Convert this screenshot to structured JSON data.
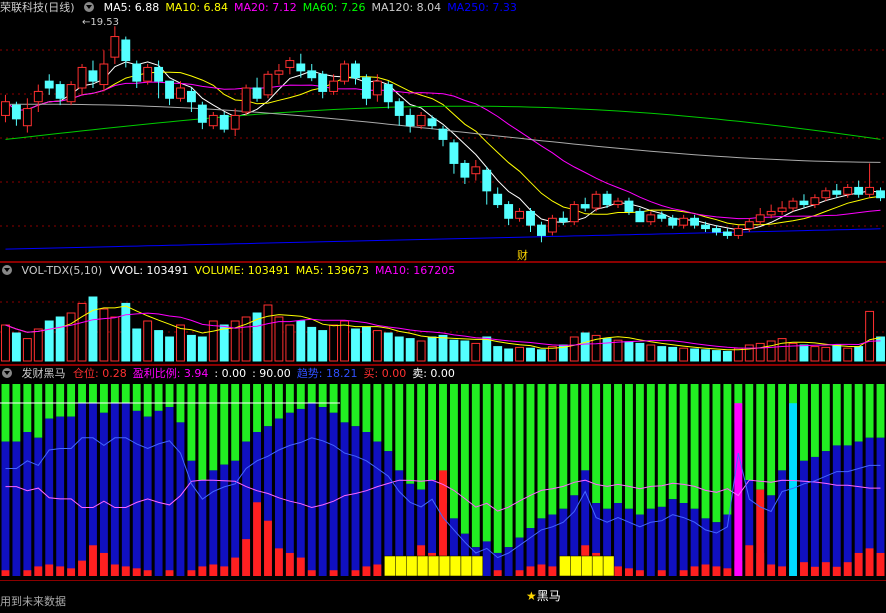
{
  "price": {
    "title": "荣联科技(日线)",
    "ma": [
      {
        "label": "MA5: 6.88",
        "color": "#ffffff"
      },
      {
        "label": "MA10: 6.84",
        "color": "#ffff00"
      },
      {
        "label": "MA20: 7.12",
        "color": "#ff00ff"
      },
      {
        "label": "MA60: 7.26",
        "color": "#00ff00"
      },
      {
        "label": "MA120: 8.04",
        "color": "#cccccc"
      },
      {
        "label": "MA250: 7.33",
        "color": "#0000ff"
      }
    ],
    "high_label": "19.53",
    "marker_cai": "财"
  },
  "volume": {
    "title": "VOL-TDX(5,10)",
    "items": [
      {
        "label": "VVOL: 103491",
        "color": "#ffffff"
      },
      {
        "label": "VOLUME: 103491",
        "color": "#ffff00"
      },
      {
        "label": "MA5: 139673",
        "color": "#ffff00"
      },
      {
        "label": "MA10: 167205",
        "color": "#ff00ff"
      }
    ]
  },
  "indicator": {
    "title": "发财黑马",
    "items": [
      {
        "label": "仓位: 0.28",
        "color": "#ff3030"
      },
      {
        "label": "盈利比例: 3.94",
        "color": "#ff00ff"
      },
      {
        "label": ": 0.00",
        "color": "#ffffff"
      },
      {
        "label": ": 90.00",
        "color": "#ffffff"
      },
      {
        "label": "趋势: 18.21",
        "color": "#3050ff"
      },
      {
        "label": "买: 0.00",
        "color": "#ff3030"
      },
      {
        "label": "卖: 0.00",
        "color": "#ffffff"
      }
    ],
    "star_label": "黑马"
  },
  "footer": {
    "note": "用到未来数据"
  },
  "colors": {
    "up": "#ff3030",
    "down": "#54ffff",
    "bg": "#000000"
  },
  "chart_data": {
    "type": "candlestick",
    "candles": [
      [
        7.9,
        8.3,
        7.7,
        8.5
      ],
      [
        8.2,
        7.8,
        7.6,
        8.3
      ],
      [
        7.6,
        8.1,
        7.4,
        8.4
      ],
      [
        8.3,
        8.6,
        8.0,
        8.8
      ],
      [
        8.9,
        8.7,
        8.5,
        9.1
      ],
      [
        8.8,
        8.4,
        8.2,
        8.9
      ],
      [
        8.3,
        8.8,
        8.2,
        8.9
      ],
      [
        8.7,
        9.3,
        8.5,
        9.4
      ],
      [
        9.2,
        8.9,
        8.7,
        9.5
      ],
      [
        8.8,
        9.4,
        8.6,
        9.8
      ],
      [
        9.6,
        10.2,
        9.4,
        10.5
      ],
      [
        10.1,
        9.5,
        9.3,
        10.2
      ],
      [
        9.4,
        8.9,
        8.7,
        9.5
      ],
      [
        8.9,
        9.3,
        8.8,
        9.4
      ],
      [
        9.3,
        8.9,
        8.4,
        9.5
      ],
      [
        8.9,
        8.4,
        8.2,
        8.9
      ],
      [
        8.4,
        8.7,
        8.3,
        8.9
      ],
      [
        8.6,
        8.3,
        8.0,
        8.7
      ],
      [
        8.2,
        7.7,
        7.5,
        8.3
      ],
      [
        7.6,
        7.9,
        7.5,
        8.0
      ],
      [
        7.9,
        7.5,
        7.4,
        8.0
      ],
      [
        7.5,
        7.9,
        7.3,
        8.1
      ],
      [
        8.0,
        8.7,
        7.9,
        8.8
      ],
      [
        8.7,
        8.4,
        8.3,
        9.0
      ],
      [
        8.5,
        9.1,
        8.4,
        9.2
      ],
      [
        9.1,
        9.2,
        8.8,
        9.4
      ],
      [
        9.3,
        9.5,
        9.1,
        9.6
      ],
      [
        9.4,
        9.2,
        9.0,
        9.7
      ],
      [
        9.2,
        9.0,
        8.9,
        9.4
      ],
      [
        9.1,
        8.6,
        8.4,
        9.2
      ],
      [
        8.6,
        8.9,
        8.5,
        9.1
      ],
      [
        8.9,
        9.4,
        8.8,
        9.5
      ],
      [
        9.4,
        9.0,
        8.8,
        9.5
      ],
      [
        9.0,
        8.4,
        8.2,
        9.1
      ],
      [
        8.5,
        8.9,
        8.3,
        9.1
      ],
      [
        8.8,
        8.3,
        8.1,
        8.9
      ],
      [
        8.3,
        7.9,
        7.6,
        8.4
      ],
      [
        7.9,
        7.6,
        7.4,
        8.1
      ],
      [
        7.6,
        7.9,
        7.5,
        8.0
      ],
      [
        7.8,
        7.6,
        7.5,
        7.9
      ],
      [
        7.5,
        7.2,
        7.0,
        7.6
      ],
      [
        7.1,
        6.5,
        6.2,
        7.2
      ],
      [
        6.5,
        6.1,
        5.9,
        6.6
      ],
      [
        6.2,
        6.4,
        6.0,
        6.6
      ],
      [
        6.3,
        5.7,
        5.3,
        6.4
      ],
      [
        5.6,
        5.3,
        5.2,
        5.8
      ],
      [
        5.3,
        4.9,
        4.7,
        5.4
      ],
      [
        4.9,
        5.1,
        4.8,
        5.2
      ],
      [
        5.1,
        4.7,
        4.5,
        5.2
      ],
      [
        4.7,
        4.4,
        4.2,
        4.8
      ],
      [
        4.5,
        4.9,
        4.4,
        5.0
      ],
      [
        4.9,
        4.8,
        4.7,
        5.1
      ],
      [
        4.8,
        5.3,
        4.7,
        5.4
      ],
      [
        5.3,
        5.2,
        5.1,
        5.5
      ],
      [
        5.2,
        5.6,
        5.1,
        5.7
      ],
      [
        5.6,
        5.3,
        5.2,
        5.7
      ],
      [
        5.3,
        5.4,
        5.2,
        5.5
      ],
      [
        5.4,
        5.1,
        5.0,
        5.5
      ],
      [
        5.1,
        4.8,
        4.8,
        5.2
      ],
      [
        4.8,
        5.0,
        4.7,
        5.1
      ],
      [
        5.0,
        4.9,
        4.8,
        5.1
      ],
      [
        4.9,
        4.7,
        4.6,
        5.0
      ],
      [
        4.7,
        4.9,
        4.6,
        5.0
      ],
      [
        4.9,
        4.7,
        4.6,
        5.0
      ],
      [
        4.7,
        4.6,
        4.5,
        4.8
      ],
      [
        4.6,
        4.5,
        4.4,
        4.7
      ],
      [
        4.5,
        4.4,
        4.3,
        4.6
      ],
      [
        4.4,
        4.6,
        4.3,
        4.7
      ],
      [
        4.6,
        4.8,
        4.5,
        4.9
      ],
      [
        4.8,
        5.0,
        4.7,
        5.2
      ],
      [
        5.0,
        5.1,
        4.9,
        5.3
      ],
      [
        5.1,
        5.2,
        5.0,
        5.4
      ],
      [
        5.2,
        5.4,
        5.1,
        5.5
      ],
      [
        5.4,
        5.3,
        5.2,
        5.6
      ],
      [
        5.3,
        5.5,
        5.2,
        5.6
      ],
      [
        5.5,
        5.7,
        5.4,
        5.8
      ],
      [
        5.7,
        5.6,
        5.5,
        5.9
      ],
      [
        5.6,
        5.8,
        5.5,
        5.9
      ],
      [
        5.8,
        5.6,
        5.5,
        6.0
      ],
      [
        5.6,
        5.8,
        5.5,
        6.5
      ],
      [
        5.7,
        5.5,
        5.4,
        5.8
      ]
    ],
    "volume": [
      0.45,
      0.35,
      0.28,
      0.4,
      0.5,
      0.55,
      0.6,
      0.72,
      0.8,
      0.65,
      0.55,
      0.72,
      0.4,
      0.5,
      0.38,
      0.3,
      0.45,
      0.32,
      0.3,
      0.5,
      0.45,
      0.5,
      0.55,
      0.6,
      0.7,
      0.55,
      0.45,
      0.5,
      0.42,
      0.38,
      0.45,
      0.5,
      0.4,
      0.42,
      0.38,
      0.35,
      0.3,
      0.28,
      0.25,
      0.3,
      0.32,
      0.26,
      0.25,
      0.22,
      0.3,
      0.18,
      0.15,
      0.17,
      0.16,
      0.14,
      0.18,
      0.2,
      0.3,
      0.35,
      0.32,
      0.28,
      0.26,
      0.24,
      0.22,
      0.2,
      0.18,
      0.17,
      0.16,
      0.15,
      0.14,
      0.13,
      0.12,
      0.16,
      0.2,
      0.22,
      0.25,
      0.28,
      0.22,
      0.2,
      0.18,
      0.17,
      0.2,
      0.16,
      0.18,
      0.62,
      0.3
    ],
    "indicator_bars": [
      0.7,
      0.7,
      0.75,
      0.72,
      0.82,
      0.83,
      0.83,
      0.9,
      0.9,
      0.85,
      0.9,
      0.9,
      0.86,
      0.83,
      0.86,
      0.88,
      0.8,
      0.6,
      0.5,
      0.55,
      0.58,
      0.6,
      0.7,
      0.75,
      0.78,
      0.82,
      0.85,
      0.87,
      0.9,
      0.88,
      0.85,
      0.8,
      0.78,
      0.75,
      0.7,
      0.65,
      0.55,
      0.48,
      0.45,
      0.5,
      0.38,
      0.3,
      0.22,
      0.15,
      0.18,
      0.12,
      0.15,
      0.2,
      0.25,
      0.3,
      0.32,
      0.35,
      0.42,
      0.55,
      0.38,
      0.35,
      0.38,
      0.35,
      0.32,
      0.35,
      0.36,
      0.4,
      0.38,
      0.35,
      0.3,
      0.28,
      0.32,
      0.8,
      0.5,
      0.45,
      0.42,
      0.55,
      0.57,
      0.6,
      0.62,
      0.65,
      0.68,
      0.68,
      0.7,
      0.72,
      0.72
    ]
  }
}
